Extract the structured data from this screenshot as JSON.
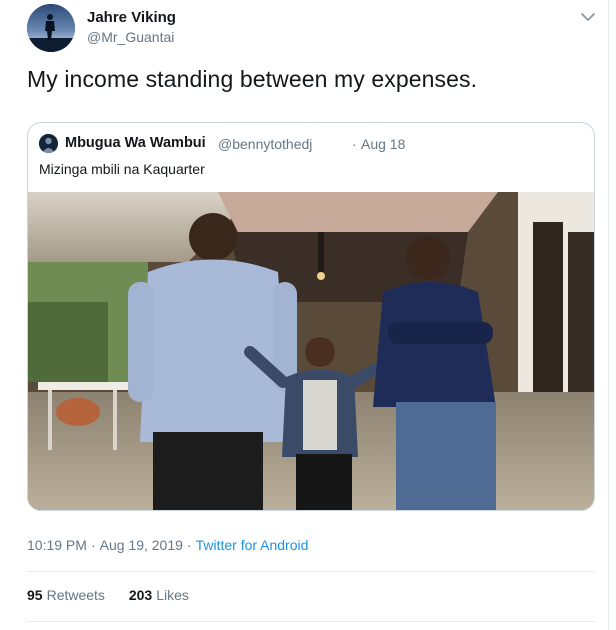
{
  "author": {
    "name": "Jahre Viking",
    "handle": "@Mr_Guantai"
  },
  "tweet": {
    "text": "My income standing between my expenses."
  },
  "quoted": {
    "name": "Mbugua Wa Wambui",
    "handle": "@bennytothedj",
    "separator": "·",
    "date": "Aug 18",
    "text": "Mizinga mbili na Kaquarter"
  },
  "meta": {
    "time": "10:19 PM",
    "date": "Aug 19, 2019",
    "separator": "·",
    "source": "Twitter for Android"
  },
  "stats": {
    "retweets_count": "95",
    "retweets_label": "Retweets",
    "likes_count": "203",
    "likes_label": "Likes"
  },
  "colors": {
    "link": "#1b95e0",
    "secondary_text": "#657786",
    "border": "#e6ecf0"
  },
  "icons": {
    "caret": "chevron-down-icon"
  }
}
